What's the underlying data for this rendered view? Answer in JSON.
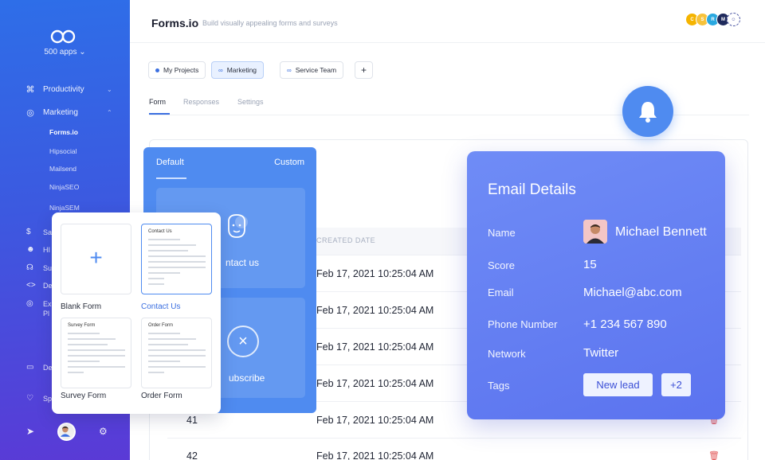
{
  "sidebar": {
    "apps_label": "500 apps",
    "nav": [
      {
        "label": "Productivity",
        "icon": "command-icon"
      },
      {
        "label": "Marketing",
        "icon": "globe-icon"
      }
    ],
    "marketing_items": [
      "Forms.io",
      "Hipsocial",
      "Mailsend",
      "NinjaSEO",
      "NinjaSEM"
    ],
    "partial_items": [
      "Sa",
      "HI",
      "Su",
      "De",
      "Ex",
      "Pl",
      "De",
      "Sp"
    ]
  },
  "header": {
    "brand": "Forms.io",
    "tagline": "Build visually appealing forms and surveys",
    "avatars": [
      "C",
      "S",
      "R",
      "M"
    ]
  },
  "projects": [
    {
      "label": "My Projects",
      "icon": "dot"
    },
    {
      "label": "Marketing",
      "icon": "link-icon"
    },
    {
      "label": "Service Team",
      "icon": "link-icon"
    }
  ],
  "add_project": "+",
  "tabs": [
    "Form",
    "Responses",
    "Settings"
  ],
  "table": {
    "column": "CREATED DATE",
    "rows": [
      {
        "idx": "",
        "date": "Feb 17, 2021 10:25:04 AM"
      },
      {
        "idx": "",
        "date": "Feb 17, 2021 10:25:04 AM"
      },
      {
        "idx": "",
        "date": "Feb 17, 2021 10:25:04 AM"
      },
      {
        "idx": "",
        "date": "Feb 17, 2021 10:25:04 AM"
      },
      {
        "idx": "41",
        "date": "Feb 17, 2021 10:25:04 AM"
      },
      {
        "idx": "42",
        "date": "Feb 17, 2021 10:25:04 AM"
      }
    ]
  },
  "template_panel": {
    "tabs": [
      "Default",
      "Custom"
    ],
    "cards": [
      "ntact us",
      "ubscribe"
    ]
  },
  "chooser": {
    "tiles": [
      {
        "label": "Blank Form",
        "title": ""
      },
      {
        "label": "Contact Us",
        "title": "Contact Us"
      },
      {
        "label": "Survey Form",
        "title": "Survey Form"
      },
      {
        "label": "Order Form",
        "title": "Order Form"
      }
    ]
  },
  "email_details": {
    "title": "Email Details",
    "fields": {
      "name_label": "Name",
      "name": "Michael Bennett",
      "score_label": "Score",
      "score": "15",
      "email_label": "Email",
      "email": "Michael@abc.com",
      "phone_label": "Phone Number",
      "phone": "+1 234 567 890",
      "network_label": "Network",
      "network": "Twitter",
      "tags_label": "Tags"
    },
    "tags": [
      "New lead",
      "+2"
    ]
  },
  "colors": {
    "accent": "#4f8bf0",
    "sidebar_top": "#2e6ee8",
    "sidebar_bottom": "#5a3ad6",
    "email_card": "#6a85f4",
    "danger": "#e25a5a"
  }
}
